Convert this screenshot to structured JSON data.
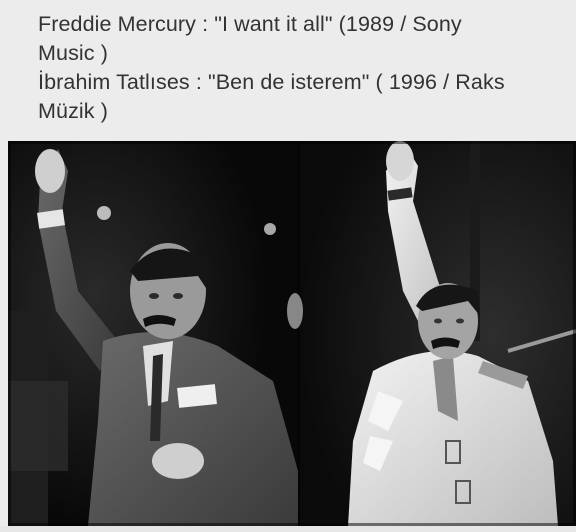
{
  "caption": {
    "line1": "Freddie Mercury : \"I want it all\" (1989 / Sony",
    "line2": "Music )",
    "line3": "İbrahim Tatlıses : \"Ben de isterem\" ( 1996 / Raks",
    "line4": "Müzik )"
  },
  "photo": {
    "style": "black-and-white",
    "left_subject": "man-in-suit-raising-right-fist",
    "right_subject": "man-in-white-jacket-raising-right-fist"
  },
  "colors": {
    "background": "#ececec",
    "text": "#333333",
    "photo_dark": "#0b0b0b",
    "jacket_white": "#e8e8e8",
    "suit_gray": "#5a5a5a"
  }
}
